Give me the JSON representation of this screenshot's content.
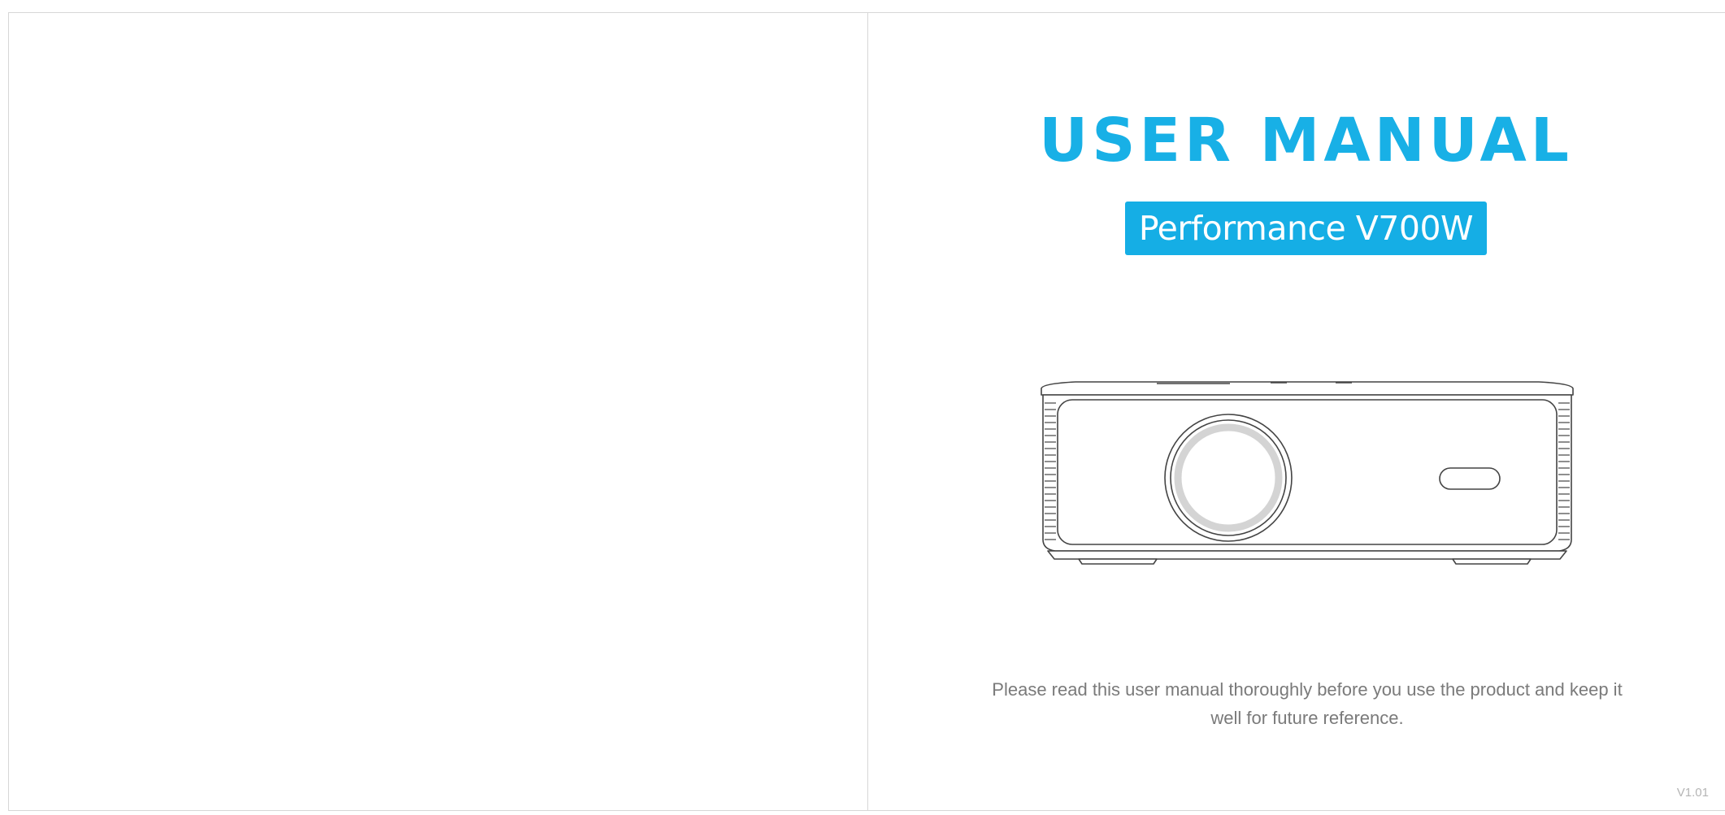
{
  "cover": {
    "title": "USER MANUAL",
    "model": "Performance V700W",
    "note": "Please read this user manual thoroughly before you use the product and keep it well for future reference.",
    "version": "V1.01",
    "illustration_icon": "projector-line-drawing",
    "accent_color": "#18b0e6"
  }
}
